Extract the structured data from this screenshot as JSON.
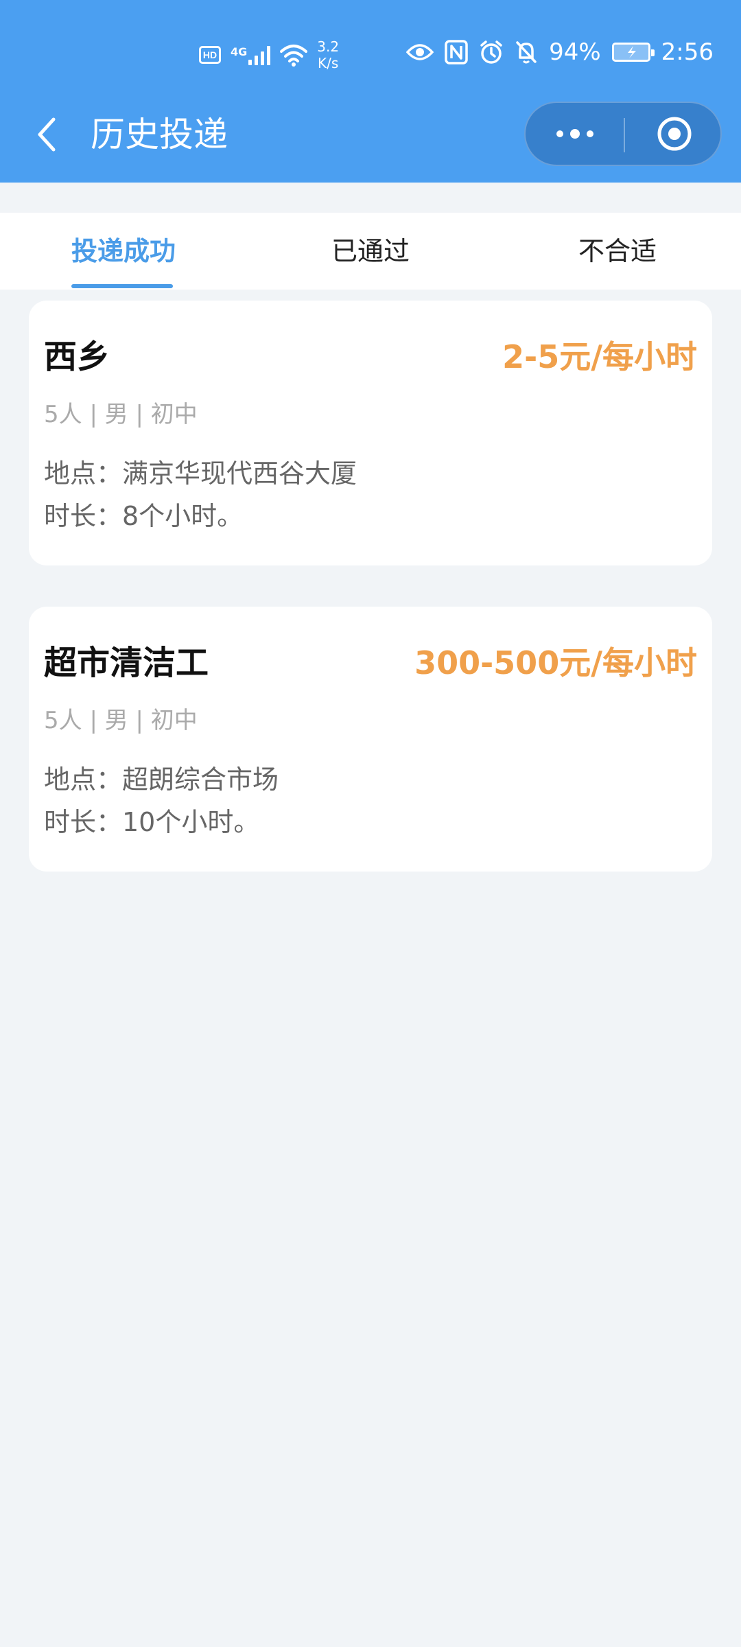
{
  "status_bar": {
    "hd_label": "HD",
    "network_type": "4G",
    "speed_value": "3.2",
    "speed_unit": "K/s",
    "battery_percent": "94%",
    "time": "2:56"
  },
  "nav": {
    "title": "历史投递"
  },
  "tabs": [
    {
      "label": "投递成功",
      "active": true
    },
    {
      "label": "已通过",
      "active": false
    },
    {
      "label": "不合适",
      "active": false
    }
  ],
  "cards": [
    {
      "title": "西乡",
      "salary": "2-5元/每小时",
      "tags": "5人 | 男 | 初中",
      "location": "地点：满京华现代西谷大厦",
      "duration": "时长：8个小时。"
    },
    {
      "title": "超市清洁工",
      "salary": "300-500元/每小时",
      "tags": "5人 | 男 | 初中",
      "location": "地点：超朗综合市场",
      "duration": "时长：10个小时。"
    }
  ],
  "colors": {
    "header_bg": "#4b9ff1",
    "accent": "#4a9ce8",
    "salary": "#f0a04b",
    "page_bg": "#f1f4f7"
  }
}
